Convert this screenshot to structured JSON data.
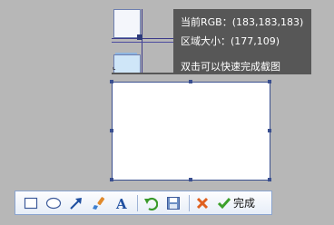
{
  "info": {
    "rgb_text": "当前RGB：(183,183,183)",
    "size_text": "区域大小：(177,109)",
    "hint_text": "双击可以快速完成截图"
  },
  "toolbar": {
    "done_label": "完成",
    "tools": [
      "rectangle-icon",
      "ellipse-icon",
      "arrow-icon",
      "brush-icon",
      "text-icon",
      "undo-icon",
      "save-icon",
      "cancel-icon",
      "check-icon"
    ]
  },
  "colors": {
    "background": "#b7b7b7",
    "panel": "#575757",
    "selection_border": "#3a4f8f",
    "toolbar_border": "#8aa4cf"
  }
}
